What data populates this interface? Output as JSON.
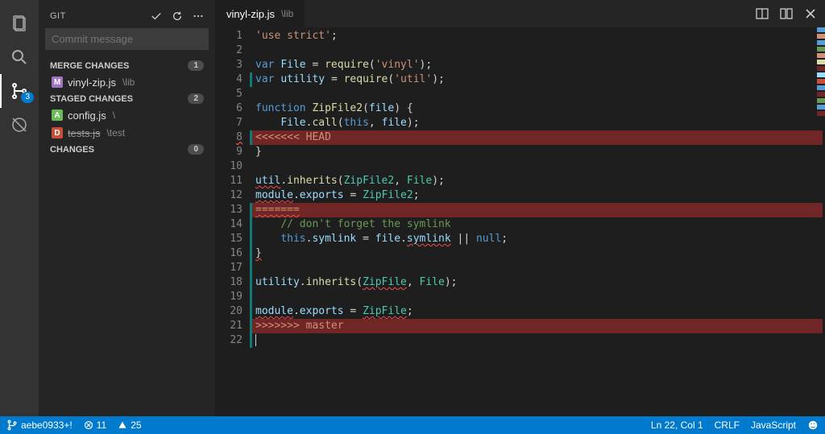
{
  "activitybar": {
    "scm_badge": "3"
  },
  "sidebar": {
    "title": "GIT",
    "commit_placeholder": "Commit message",
    "sections": {
      "merge": {
        "label": "MERGE CHANGES",
        "count": "1"
      },
      "staged": {
        "label": "STAGED CHANGES",
        "count": "2"
      },
      "changes": {
        "label": "CHANGES",
        "count": "0"
      }
    },
    "merge_file": {
      "name": "vinyl-zip.js",
      "path": "\\lib",
      "icon": "M"
    },
    "staged_a": {
      "name": "config.js",
      "path": "\\",
      "icon": "A"
    },
    "staged_d": {
      "name": "tests.js",
      "path": "\\test",
      "icon": "D"
    }
  },
  "tab": {
    "name": "vinyl-zip.js",
    "path": "\\lib"
  },
  "code": {
    "l1": {
      "n": "1",
      "html": "<span class='s'>'use strict'</span><span class='pl'>;</span>"
    },
    "l2": {
      "n": "2",
      "html": ""
    },
    "l3": {
      "n": "3",
      "html": "<span class='k'>var</span> <span class='id'>File</span> <span class='pl'>=</span> <span class='fn'>require</span><span class='pl'>(</span><span class='s'>'vinyl'</span><span class='pl'>);</span>"
    },
    "l4": {
      "n": "4",
      "html": "<span class='k'>var</span> <span class='id'>utility</span> <span class='pl'>=</span> <span class='fn'>require</span><span class='pl'>(</span><span class='s'>'util'</span><span class='pl'>);</span>",
      "ind": true
    },
    "l5": {
      "n": "5",
      "html": ""
    },
    "l6": {
      "n": "6",
      "html": "<span class='k'>function</span> <span class='fn'>ZipFile2</span><span class='pl'>(</span><span class='id'>file</span><span class='pl'>) {</span>"
    },
    "l7": {
      "n": "7",
      "html": "    <span class='id'>File</span><span class='pl'>.</span><span class='fn'>call</span><span class='pl'>(</span><span class='k'>this</span><span class='pl'>, </span><span class='id'>file</span><span class='pl'>);</span>"
    },
    "l8": {
      "n": "8",
      "html": "<span class='cf'>&lt;&lt;&lt;&lt;&lt;&lt;&lt; HEAD</span>",
      "hl": true,
      "ind": true,
      "err_gutter": true
    },
    "l9": {
      "n": "9",
      "html": "<span class='pl'>}</span>"
    },
    "l10": {
      "n": "10",
      "html": ""
    },
    "l11": {
      "n": "11",
      "html": "<span class='id err'>util</span><span class='pl'>.</span><span class='fn'>inherits</span><span class='pl'>(</span><span class='ty'>ZipFile2</span><span class='pl'>, </span><span class='ty'>File</span><span class='pl'>);</span>"
    },
    "l12": {
      "n": "12",
      "html": "<span class='id err'>module</span><span class='pl'>.</span><span class='id'>exports</span> <span class='pl'>=</span> <span class='ty'>ZipFile2</span><span class='pl'>;</span>"
    },
    "l13": {
      "n": "13",
      "html": "<span class='cf err'>=======</span>",
      "hl": true,
      "ind": true
    },
    "l14": {
      "n": "14",
      "html": "    <span class='cm'>// don't forget the symlink</span>",
      "ind": true
    },
    "l15": {
      "n": "15",
      "html": "    <span class='k'>this</span><span class='pl'>.</span><span class='id'>symlink</span> <span class='pl'>=</span> <span class='id'>file</span><span class='pl'>.</span><span class='id err'>symlink</span> <span class='pl'>||</span> <span class='k'>null</span><span class='pl'>;</span>",
      "ind": true
    },
    "l16": {
      "n": "16",
      "html": "<span class='pl err'>}</span>",
      "ind": true
    },
    "l17": {
      "n": "17",
      "html": "",
      "ind": true
    },
    "l18": {
      "n": "18",
      "html": "<span class='id'>utility</span><span class='pl'>.</span><span class='fn'>inherits</span><span class='pl'>(</span><span class='ty err'>ZipFile</span><span class='pl'>, </span><span class='ty'>File</span><span class='pl'>);</span>",
      "ind": true
    },
    "l19": {
      "n": "19",
      "html": "",
      "ind": true
    },
    "l20": {
      "n": "20",
      "html": "<span class='id err'>module</span><span class='pl'>.</span><span class='id'>exports</span> <span class='pl'>=</span> <span class='ty err'>ZipFile</span><span class='pl'>;</span>",
      "ind": true
    },
    "l21": {
      "n": "21",
      "html": "<span class='cf'>&gt;&gt;&gt;&gt;&gt;&gt;&gt; master</span>",
      "hl": true,
      "ind": true
    },
    "l22": {
      "n": "22",
      "html": "<span class='caret'></span>",
      "ind": true
    }
  },
  "minimap_colors": [
    "#569cd6",
    "#ce9178",
    "#569cd6",
    "#6a9955",
    "#ce9178",
    "#dcdcaa",
    "#712626",
    "#9cdcfe",
    "#c74e39",
    "#569cd6",
    "#712626",
    "#6a9955",
    "#569cd6",
    "#712626"
  ],
  "status": {
    "branch": "aebe0933+!",
    "errors": "11",
    "warnings": "25",
    "cursor": "Ln 22, Col 1",
    "eol": "CRLF",
    "lang": "JavaScript"
  }
}
